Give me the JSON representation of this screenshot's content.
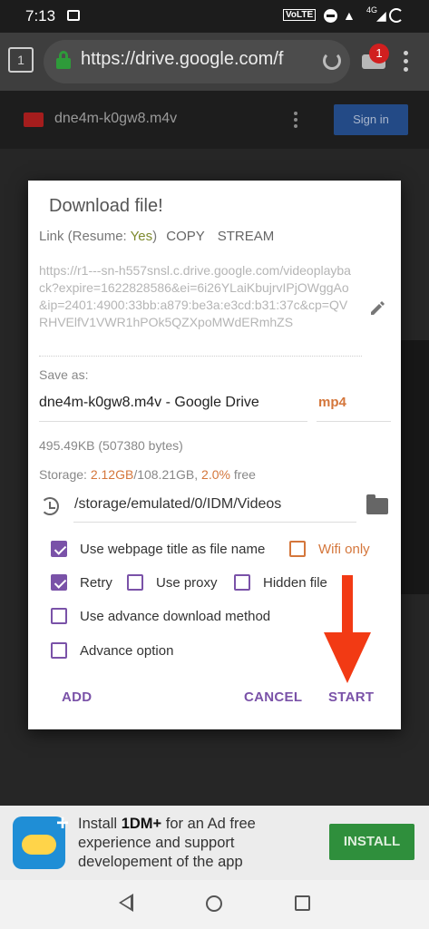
{
  "status_bar": {
    "time": "7:13",
    "volte": "VoLTE",
    "network": "4G"
  },
  "browser": {
    "tab_count": "1",
    "url": "https://drive.google.com/f",
    "download_badge": "1"
  },
  "page": {
    "file_name": "dne4m-k0gw8.m4v",
    "sign_in_label": "Sign in"
  },
  "dialog": {
    "title": "Download file!",
    "link_prefix": "Link (Resume: ",
    "resume_value": "Yes",
    "link_suffix": ")",
    "copy_label": "COPY",
    "stream_label": "STREAM",
    "link_url": "https://r1---sn-h557snsl.c.drive.google.com/videoplayback?expire=1622828586&ei=6i26YLaiKbujrvIPjOWggAo&ip=2401:4900:33bb:a879:be3a:e3cd:b31:37c&cp=QVRHVElfV1VWR1hPOk5QZXpoMWdERmhZS",
    "save_as_label": "Save as:",
    "file_name": "dne4m-k0gw8.m4v - Google Drive",
    "extension": "mp4",
    "size_text": "495.49KB (507380 bytes)",
    "storage_prefix": "Storage: ",
    "storage_used": "2.12GB",
    "storage_total": "/108.21GB, ",
    "storage_percent": "2.0%",
    "storage_suffix": " free",
    "path": "/storage/emulated/0/IDM/Videos",
    "options": {
      "use_title": {
        "label": "Use webpage title as file name",
        "checked": true
      },
      "wifi_only": {
        "label": "Wifi only",
        "checked": false
      },
      "retry": {
        "label": "Retry",
        "checked": true
      },
      "use_proxy": {
        "label": "Use proxy",
        "checked": false
      },
      "hidden_file": {
        "label": "Hidden file",
        "checked": false
      },
      "advance_method": {
        "label": "Use advance download method",
        "checked": false
      },
      "advance_option": {
        "label": "Advance option",
        "checked": false
      }
    },
    "buttons": {
      "add": "ADD",
      "cancel": "CANCEL",
      "start": "START"
    }
  },
  "ad": {
    "text_before": "Install ",
    "brand": "1DM+",
    "text_after": " for an Ad free experience and support developement of the app",
    "install_label": "INSTALL"
  },
  "colors": {
    "accent": "#7a52a8",
    "orange": "#d4763b",
    "arrow": "#f23a14",
    "install": "#2f8f3c"
  }
}
